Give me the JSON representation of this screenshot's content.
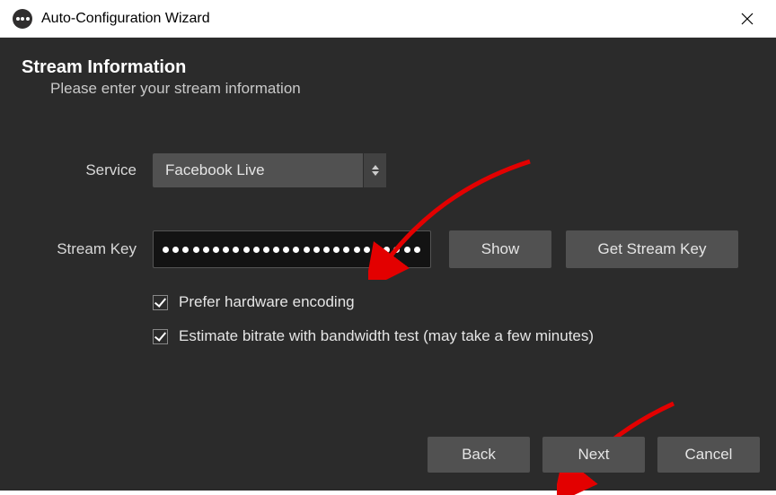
{
  "window": {
    "title": "Auto-Configuration Wizard"
  },
  "header": {
    "title": "Stream Information",
    "subtitle": "Please enter your stream information"
  },
  "form": {
    "service_label": "Service",
    "service_value": "Facebook Live",
    "streamkey_label": "Stream Key",
    "streamkey_masked_length": 26,
    "show_button": "Show",
    "get_key_button": "Get Stream Key"
  },
  "options": {
    "prefer_hw": {
      "checked": true,
      "label": "Prefer hardware encoding"
    },
    "estimate_bitrate": {
      "checked": true,
      "label": "Estimate bitrate with bandwidth test (may take a few minutes)"
    }
  },
  "footer": {
    "back": "Back",
    "next": "Next",
    "cancel": "Cancel"
  }
}
